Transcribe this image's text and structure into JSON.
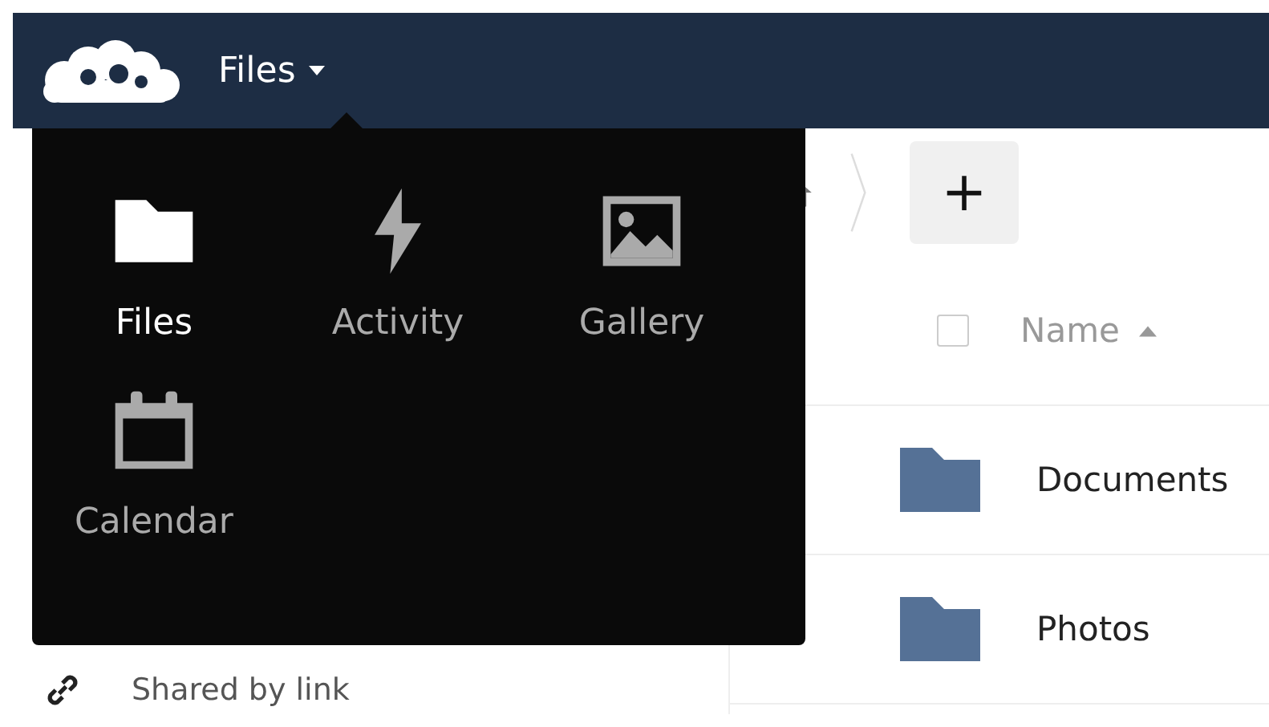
{
  "header": {
    "app_title": "Files"
  },
  "app_menu": [
    {
      "label": "Files",
      "kind": "folder",
      "selected": true
    },
    {
      "label": "Activity",
      "kind": "bolt",
      "selected": false
    },
    {
      "label": "Gallery",
      "kind": "image",
      "selected": false
    },
    {
      "label": "Calendar",
      "kind": "calendar",
      "selected": false
    }
  ],
  "sidebar": {
    "items": [
      {
        "label": "Shared by link",
        "kind": "link"
      }
    ]
  },
  "table": {
    "columns": [
      {
        "label": "Name",
        "sorted": true
      }
    ],
    "rows": [
      {
        "name": "Documents",
        "checked": false
      },
      {
        "name": "Photos",
        "checked": false
      }
    ]
  },
  "select_all": {
    "checked": false
  },
  "new_button": {
    "label": "+"
  }
}
